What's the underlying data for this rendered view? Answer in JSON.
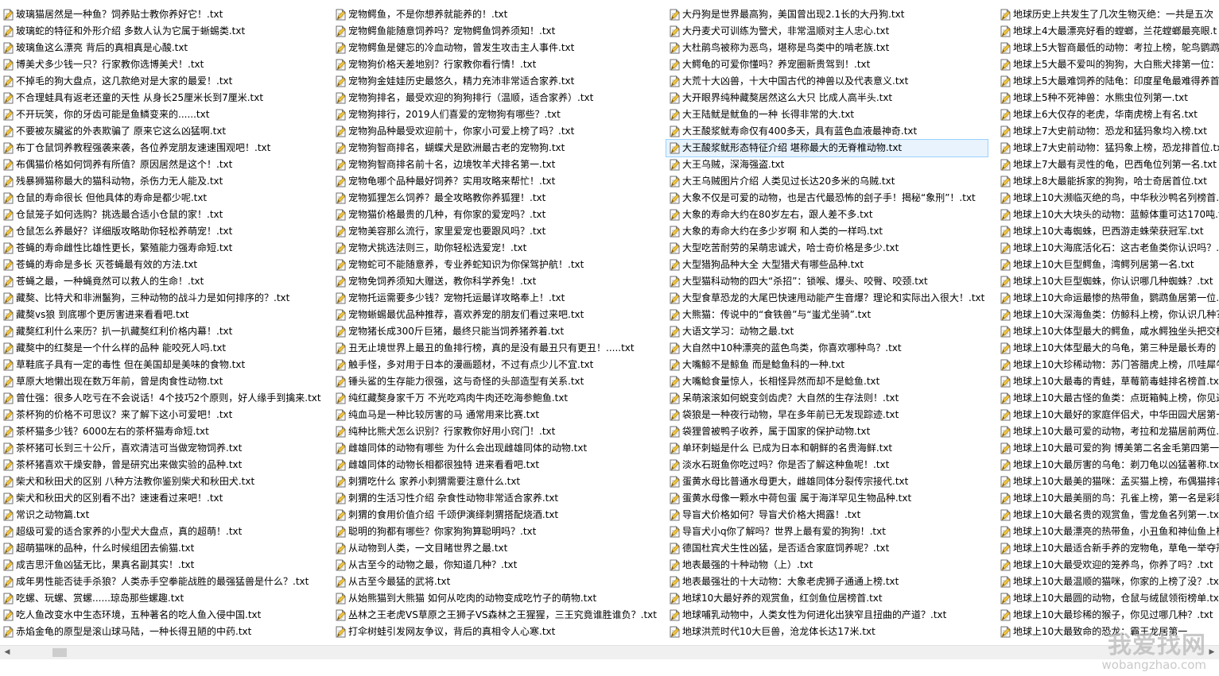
{
  "file_icon": "text-file-icon",
  "columns": [
    {
      "items": [
        "玻璃猫居然是一种鱼？饲养贴士教你养好它！.txt",
        "玻璃蛇的特征和外形介绍 多数人认为它属于蜥蜴类.txt",
        "玻璃鱼这么漂亮 背后的真相真是心酸.txt",
        "博美犬多少钱一只？行家教你选博美犬！.txt",
        "不掉毛的狗大盘点，这几款绝对是大家的最爱！.txt",
        "不合理蛙具有返老还童的天性 从身长25厘米长到7厘米.txt",
        "不开玩笑，你的牙齿可能是鱼鳞变来的......txt",
        "不要被灰臟鲨的外表欺骗了 原来它这么凶猛啊.txt",
        "布丁仓鼠饲养教程强袭来袭，各位养宠朋友速速围观吧！.txt",
        "布偶猫价格如何饲养有所值？原因居然是这个！.txt",
        "残暴狮猫称最大的猫科动物，杀伤力无人能及.txt",
        "仓鼠的寿命很长 但他具体的寿命是都少呢.txt",
        "仓鼠笼子如何选购？挑选最合适小仓鼠的家！.txt",
        "仓鼠怎么养最好？详细版攻略助你轻松养萌宠！.txt",
        "苍蝇的寿命雌性比雄性更长，繁殖能力强寿命短.txt",
        "苍蝇的寿命是多长 灭苍蝇最有效的方法.txt",
        "苍蝇之最，一种蝇竟然可以救人的生命！.txt",
        "藏獒、比特犬和非洲鬣狗，三种动物的战斗力是如何排序的？.txt",
        "藏獒vs狼 到底哪个更厉害进来看看吧.txt",
        "藏獒红利什么来历？扒一扒藏獒红利价格内幕！.txt",
        "藏獒中的红獒是一个什么样的品种 能咬死人吗.txt",
        "草鞋底子具有一定的毒性 但在美国却是美味的食物.txt",
        "草原大地懒出现在数万年前，曾是肉食性动物.txt",
        "曾仕强：很多人吃亏在不会说话！4个技巧2个原则，好人缘手到擒来.txt",
        "茶杯狗的价格不可思议？来了解下这小可爱吧！.txt",
        "茶杯猫多少钱？6000左右的茶杯猫寿命短.txt",
        "茶杯猪可长到三十公斤，喜欢清洁可当做宠物饲养.txt",
        "茶杯猪喜欢干燥安静，曾是研究出来做实验的品种.txt",
        "柴犬和秋田犬的区别 八种方法教你鉴别柴犬和秋田犬.txt",
        "柴犬和秋田犬的区别看不出？速速看过来吧！.txt",
        "常识之动物篇.txt",
        "超级可爱的适合家养的小型犬大盘点，真的超萌！.txt",
        "超萌猫咪的品种，什么时候组团去偷猫.txt",
        "成吉思汗鱼凶猛无比，果真名副其实！.txt",
        "成年男性能否徒手杀狼？人类赤手空拳能战胜的最强猛兽是什么？.txt",
        "吃螺、玩螺、赏螺......琼岛那些螺趣.txt",
        "吃人鱼改变水中生态环境，五种著名的吃人鱼入侵中国.txt",
        "赤焰金龟的原型是滚山球马陆，一种长得丑陋的中药.txt"
      ]
    },
    {
      "items": [
        "宠物鳄鱼，不是你想养就能养的！.txt",
        "宠物鳄鱼能随意饲养吗？宠物鳄鱼饲养须知！.txt",
        "宠物鳄鱼是健忘的冷血动物，曾发生攻击主人事件.txt",
        "宠物狗价格天差地别？行家教你看行情！.txt",
        "宠物狗金娃娃历史最悠久，精力充沛非常适合家养.txt",
        "宠物狗排名，最受欢迎的狗狗排行（温顺，适合家养）.txt",
        "宠物狗排行，2019人们喜爱的宠物狗有哪些？.txt",
        "宠物狗品种最受欢迎前十，你家小可爱上榜了吗？.txt",
        "宠物狗智商排名，蝴蝶犬是欧洲最古老的宠物狗.txt",
        "宠物狗智商排名前十名，边境牧羊犬排名第一.txt",
        "宠物龟哪个品种最好饲养？实用攻略来帮忙！.txt",
        "宠物狐狸怎么饲养？最全攻略教你养狐狸！.txt",
        "宠物猫价格最贵的几种，有你家的爱宠吗？.txt",
        "宠物美容那么流行，家里爱宠也要跟风吗？.txt",
        "宠物犬挑选法则三，助你轻松选爱宠！.txt",
        "宠物蛇可不能随意养，专业养蛇知识为你保驾护航！.txt",
        "宠物免饲养须知大赠送，教你科学养兔！.txt",
        "宠物托运需要多少钱？宠物托运最详攻略奉上！.txt",
        "宠物蜥蜴最优品种推荐，喜欢养宠的朋友们看过来吧.txt",
        "宠物猪长成300斤巨猪，最终只能当饲养猪养着.txt",
        "丑无止境世界上最丑的鱼排行榜，真的是没有最丑只有更丑！.....txt",
        "触手怪，多对用于日本的漫画题材，不过有点少儿不宜.txt",
        "锤头鲨的生存能力很强，这与奇怪的头部造型有关系.txt",
        "纯红藏獒身家千万 不光吃鸡肉牛肉还吃海参鲍鱼.txt",
        "纯血马是一种比较厉害的马 通常用来比赛.txt",
        "纯种比熊犬怎么识别？行家教你好用小窍门！.txt",
        "雌雄同体的动物有哪些 为什么会出现雌雄同体的动物.txt",
        "雌雄同体的动物长相都很独特 进来看看吧.txt",
        "刺猬吃什么 家养小刺猬需要注意什么.txt",
        "刺猬的生活习性介绍 杂食性动物非常适合家养.txt",
        "刺猬的食用价值介绍 千颂伊演绎刺猬搭配烧酒.txt",
        "聪明的狗都有哪些？你家狗狗算聪明吗？.txt",
        "从动物到人类，一文目睹世界之最.txt",
        "从古至今的动物之最，你知道几种？.txt",
        "从古至今最猛的武将.txt",
        "从始熊猫到大熊猫 如何从吃肉的动物变成吃竹子的萌物.txt",
        "丛林之王老虎VS草原之王狮子VS森林之王猩猩，三王究竟谁胜谁负？.txt",
        "打伞树蛙引发网友争议，背后的真相令人心寒.txt"
      ]
    },
    {
      "items": [
        "大丹狗是世界最高狗，美国曾出现2.1长的大丹狗.txt",
        "大丹麦犬可训练为警犬，非常温顺对主人忠心.txt",
        "大杜鹃鸟被称为恶鸟，堪称是鸟类中的啃老族.txt",
        "大鳄龟的可爱你懂吗？养宠圈新贵驾到！.txt",
        "大荒十大凶兽，十大中国古代的神兽以及代表意义.txt",
        "大开眼界纯种藏獒居然这么大只 比成人高半头.txt",
        "大王陆鱿是鱿鱼的一种 长得非常的大.txt",
        "大王酸浆鱿寿命仅有400多天，具有蓝色血液最神奇.txt",
        "大王酸浆鱿形态特征介绍 堪称最大的无脊椎动物.txt",
        "大王乌贼，深海强盗.txt",
        "大王乌贼图片介绍 人类见过长达20多米的乌贼.txt",
        "大象不仅是可爱的动物，也是古代最恐怖的刽子手！揭秘“象刑”！.txt",
        "大象的寿命大约在80岁左右，跟人差不多.txt",
        "大象的寿命大约在多少岁啊 和人类的一样吗.txt",
        "大型吃苦耐劳的呆萌忠诚犬，哈士奇价格是多少.txt",
        "大型猎狗品种大全 大型猎犬有哪些品种.txt",
        "大型猫科动物的四大“杀招”：锁喉、爆头、咬臀、咬颈.txt",
        "大型食草恐龙的大尾巴快速甩动能产生音爆？理论和实际出入很大！.txt",
        "大熊猫：传说中的“食铁兽”与“蚩尤坐骑”.txt",
        "大语文学习：动物之最.txt",
        "大自然中10种漂亮的蓝色鸟类，你喜欢哪种鸟？.txt",
        "大嘴鲸不是鲸鱼 而是鲶鱼科的一种.txt",
        "大嘴鲶食量惊人，长相怪异然而却不是鲶鱼.txt",
        "呆萌滚滚如何蜕变剑齿虎？大自然的生存法则！.txt",
        "袋狼是一种夜行动物，早在多年前已无发现踪迹.txt",
        "袋狸曾被鸭子收养，属于国家的保护动物.txt",
        "单环刺螠是什么 已成为日本和朝鲜的名贵海鲜.txt",
        "淡水石斑鱼你吃过吗？你是否了解这种鱼呢！.txt",
        "蛋黄水母比普通水母更大，雌雄同体分裂传宗接代.txt",
        "蛋黄水母像一颗水中荷包蛋 属于海洋罕见生物品种.txt",
        "导盲犬价格如何？导盲犬价格大揭露！.txt",
        "导盲犬小q你了解吗？世界上最有爱的狗狗！.txt",
        "德国杜宾犬生性凶猛，是否适合家庭饲养呢？.txt",
        "地表最强的十种动物（上）.txt",
        "地表最强壮的十大动物：大象老虎狮子通通上榜.txt",
        "地球10大最好养的观赏鱼，红剑鱼位居榜首.txt",
        "地球哺乳动物中，人类女性为何进化出狭窄且扭曲的产道？.txt",
        "地球洪荒时代10大巨兽，沧龙体长达17米.txt"
      ]
    },
    {
      "items": [
        "地球历史上共发生了几次生物灭绝：一共是五次",
        "地球上4大最漂亮好看的螳螂，兰花螳螂最亮眼.t",
        "地球上5大智商最低的动物：考拉上榜，鸵鸟鹦鹉",
        "地球上5大最不爱叫的狗狗，大白熊犬排第一位：",
        "地球上5大最难饲养的陆龟：印度星龟最难得养首.tx",
        "地球上5种不死神兽：水熊虫位列第一.txt",
        "地球上6大仅存的老虎，华南虎榜上有名.txt",
        "地球上7大史前动物：恐龙和猛犸象均入榜.txt",
        "地球上7大史前动物：猛犸象上榜，恐龙排首位.tx",
        "地球上7大最有灵性的龟，巴西龟位列第一名.txt",
        "地球上8大最能拆家的狗狗，哈士奇居首位.txt",
        "地球上10大濒临灭绝的鸟，中华秋沙鸭名列榜首.t",
        "地球上10大大块头的动物：蓝鲸体重可达170吨.t",
        "地球上10大毒蜘蛛，巴西游走蛛荣获冠军.txt",
        "地球上10大海底活化石：这古老鱼类你认识吗？.t",
        "地球上10大巨型鳄鱼，湾鳄列居第一名.txt",
        "地球上10大巨型蜘蛛，你认识哪几种蜘蛛？.txt",
        "地球上10大命运最惨的热带鱼，鹦鹉鱼居第一位.t",
        "地球上10大深海鱼类：仿鲸科上榜，你认识几种？",
        "地球上10大体型最大的鳄鱼，咸水鳄独坐头把交椅",
        "地球上10大体型最大的乌龟，第三种是最长寿的",
        "地球上10大珍稀动物：苏门答腊虎上榜，爪哇犀牛",
        "地球上10大最毒的青蛙，草莓箭毒蛙排名榜首.txt",
        "地球上10大最古怪的鱼类：点斑箱鲀上榜，你见过",
        "地球上10大最好的家庭伴侣犬，中华田园犬居第一",
        "地球上10大最可爱的动物，考拉和龙猫居前两位.t",
        "地球上10大最可爱的狗 博美第二名金毛第四第一名",
        "地球上10大最厉害的乌龟：剃刀龟以凶猛著称.txt",
        "地球上10大最美的猫咪：孟买猫上榜，布偶猫排名",
        "地球上10大最美丽的鸟：孔雀上榜，第一名是彩鹮",
        "地球上10大最名贵的观赏鱼，雪龙鱼名列第一.txt",
        "地球上10大最漂亮的热带鱼，小丑鱼和神仙鱼上榜",
        "地球上10大最适合新手养的宠物龟，草龟一举夺冠",
        "地球上10大最受欢迎的笼养鸟，你养了吗？.txt",
        "地球上10大最温顺的猫咪，你家的上榜了没？.txt",
        "地球上10大最圆的动物，仓鼠与绒鼠领衔榜单.txt",
        "地球上10大最珍稀的猴子，你见过哪几种？.txt",
        "地球上10大最致命的恐龙：霸王龙居第一"
      ]
    }
  ],
  "selected": {
    "column": 2,
    "row": 8
  },
  "scrollbar": {
    "left_arrow": "◀",
    "right_arrow": "▶",
    "position": 0.04
  },
  "watermark": {
    "brand": "我爱找网",
    "url": "wobangzhao.com"
  }
}
